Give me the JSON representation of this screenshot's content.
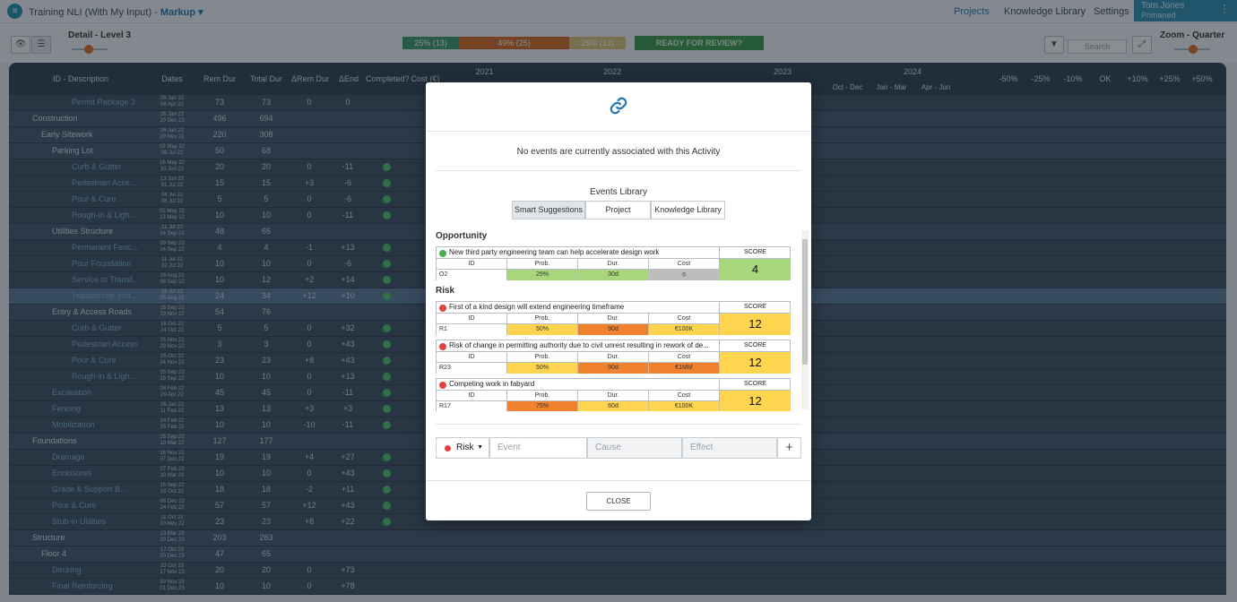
{
  "app": {
    "logo_glyph": "≡",
    "title": "Training NLI (With My Input)",
    "mode": "Markup",
    "nav": [
      "Projects",
      "Knowledge Library",
      "Settings"
    ],
    "user_name": "Tom Jones",
    "user_org": "Primaned"
  },
  "toolbar": {
    "detail_label": "Detail - Level 3",
    "progress": [
      {
        "label": "25% (13)",
        "fraction": 0.25,
        "color": "#3a9a6b"
      },
      {
        "label": "49% (25)",
        "fraction": 0.49,
        "color": "#d4691f"
      },
      {
        "label": "25% (13)",
        "fraction": 0.25,
        "color": "#d8c27a"
      }
    ],
    "ready_label": "READY FOR REVIEW?",
    "search_placeholder": "Search",
    "zoom_label": "Zoom - Quarter"
  },
  "grid": {
    "columns": [
      "ID - Description",
      "Dates",
      "Rem Dur",
      "Total Dur",
      "ΔRem Dur",
      "ΔEnd",
      "Completed?",
      "Cost (€)"
    ],
    "years": [
      "2021",
      "2022",
      "2023",
      "2024"
    ],
    "quarters": [
      "Oct - Dec",
      "Jan - Mar",
      "Apr - Jun"
    ],
    "right_cols": [
      "-50%",
      "-25%",
      "-10%",
      "OK",
      "+10%",
      "+25%",
      "+50%"
    ],
    "rows": [
      {
        "name": "Permit Package 3",
        "dates": [
          "26 Jan 22",
          "08 Apr 22"
        ],
        "rem": "73",
        "total": "73",
        "drem": "0",
        "dend": "0",
        "level": 3,
        "group": false,
        "done": false
      },
      {
        "name": "Construction",
        "dates": [
          "26 Jan 22",
          "20 Dec 23"
        ],
        "rem": "496",
        "total": "694",
        "drem": "",
        "dend": "",
        "level": 0,
        "group": true,
        "done": false
      },
      {
        "name": "Early Sitework",
        "dates": [
          "26 Jan 22",
          "29 Nov 22"
        ],
        "rem": "220",
        "total": "308",
        "drem": "",
        "dend": "",
        "level": 1,
        "group": true,
        "done": false
      },
      {
        "name": "Parking Lot",
        "dates": [
          "02 May 22",
          "08 Jul 22"
        ],
        "rem": "50",
        "total": "68",
        "drem": "",
        "dend": "",
        "level": 2,
        "group": true,
        "done": false
      },
      {
        "name": "Curb & Gutter",
        "dates": [
          "16 May 22",
          "10 Jun 22"
        ],
        "rem": "20",
        "total": "20",
        "drem": "0",
        "dend": "-11",
        "level": 3,
        "group": false,
        "done": true
      },
      {
        "name": "Pedestrian Acce...",
        "dates": [
          "13 Jun 22",
          "01 Jul 22"
        ],
        "rem": "15",
        "total": "15",
        "drem": "+3",
        "dend": "-6",
        "level": 3,
        "group": false,
        "done": true
      },
      {
        "name": "Pour & Cure",
        "dates": [
          "04 Jul 22",
          "08 Jul 22"
        ],
        "rem": "5",
        "total": "5",
        "drem": "0",
        "dend": "-6",
        "level": 3,
        "group": false,
        "done": true
      },
      {
        "name": "Rough-in & Ligh...",
        "dates": [
          "02 May 22",
          "13 May 22"
        ],
        "rem": "10",
        "total": "10",
        "drem": "0",
        "dend": "-11",
        "level": 3,
        "group": false,
        "done": true
      },
      {
        "name": "Utilities Structure",
        "dates": [
          "11 Jul 22",
          "14 Sep 22"
        ],
        "rem": "48",
        "total": "66",
        "drem": "",
        "dend": "",
        "level": 2,
        "group": true,
        "done": false
      },
      {
        "name": "Permanent Fenc...",
        "dates": [
          "09 Sep 22",
          "14 Sep 22"
        ],
        "rem": "4",
        "total": "4",
        "drem": "-1",
        "dend": "+13",
        "level": 3,
        "group": false,
        "done": true
      },
      {
        "name": "Pour Foundation",
        "dates": [
          "11 Jul 22",
          "22 Jul 22"
        ],
        "rem": "10",
        "total": "10",
        "drem": "0",
        "dend": "-6",
        "level": 3,
        "group": false,
        "done": true
      },
      {
        "name": "Service to Transf...",
        "dates": [
          "26 Aug 22",
          "08 Sep 22"
        ],
        "rem": "10",
        "total": "12",
        "drem": "+2",
        "dend": "+14",
        "level": 3,
        "group": false,
        "done": true
      },
      {
        "name": "Transformer Inst...",
        "dates": [
          "25 Jul 22",
          "25 Aug 22"
        ],
        "rem": "24",
        "total": "34",
        "drem": "+12",
        "dend": "+10",
        "level": 3,
        "group": false,
        "done": true
      },
      {
        "name": "Entry & Access Roads",
        "dates": [
          "15 Sep 22",
          "29 Nov 22"
        ],
        "rem": "54",
        "total": "76",
        "drem": "",
        "dend": "",
        "level": 2,
        "group": true,
        "done": false
      },
      {
        "name": "Curb & Gutter",
        "dates": [
          "18 Oct 22",
          "24 Oct 22"
        ],
        "rem": "5",
        "total": "5",
        "drem": "0",
        "dend": "+32",
        "level": 3,
        "group": false,
        "done": true
      },
      {
        "name": "Pedestrian Access",
        "dates": [
          "25 Nov 22",
          "29 Nov 22"
        ],
        "rem": "3",
        "total": "3",
        "drem": "0",
        "dend": "+43",
        "level": 3,
        "group": false,
        "done": true
      },
      {
        "name": "Pour & Cure",
        "dates": [
          "25 Oct 22",
          "24 Nov 22"
        ],
        "rem": "23",
        "total": "23",
        "drem": "+8",
        "dend": "+43",
        "level": 3,
        "group": false,
        "done": true
      },
      {
        "name": "Rough-in & Ligh...",
        "dates": [
          "15 Sep 22",
          "28 Sep 22"
        ],
        "rem": "10",
        "total": "10",
        "drem": "0",
        "dend": "+13",
        "level": 3,
        "group": false,
        "done": true
      },
      {
        "name": "Excavation",
        "dates": [
          "28 Feb 22",
          "29 Apr 22"
        ],
        "rem": "45",
        "total": "45",
        "drem": "0",
        "dend": "-11",
        "level": 2,
        "group": false,
        "done": true
      },
      {
        "name": "Fencing",
        "dates": [
          "26 Jan 22",
          "11 Feb 22"
        ],
        "rem": "13",
        "total": "13",
        "drem": "+3",
        "dend": "+3",
        "level": 2,
        "group": false,
        "done": true
      },
      {
        "name": "Mobilization",
        "dates": [
          "14 Feb 22",
          "25 Feb 22"
        ],
        "rem": "10",
        "total": "10",
        "drem": "-10",
        "dend": "-11",
        "level": 2,
        "group": false,
        "done": true
      },
      {
        "name": "Foundations",
        "dates": [
          "15 Sep 22",
          "10 Mar 23"
        ],
        "rem": "127",
        "total": "177",
        "drem": "",
        "dend": "",
        "level": 0,
        "group": true,
        "done": false
      },
      {
        "name": "Drainage",
        "dates": [
          "16 Nov 22",
          "07 Dec 22"
        ],
        "rem": "19",
        "total": "19",
        "drem": "+4",
        "dend": "+27",
        "level": 2,
        "group": false,
        "done": true
      },
      {
        "name": "Enclosures",
        "dates": [
          "27 Feb 23",
          "10 Mar 23"
        ],
        "rem": "10",
        "total": "10",
        "drem": "0",
        "dend": "+43",
        "level": 2,
        "group": false,
        "done": true
      },
      {
        "name": "Grade & Support B...",
        "dates": [
          "15 Sep 22",
          "10 Oct 22"
        ],
        "rem": "18",
        "total": "18",
        "drem": "-2",
        "dend": "+11",
        "level": 2,
        "group": false,
        "done": true
      },
      {
        "name": "Pour & Cure",
        "dates": [
          "08 Dec 22",
          "24 Feb 23"
        ],
        "rem": "57",
        "total": "57",
        "drem": "+12",
        "dend": "+43",
        "level": 2,
        "group": false,
        "done": true
      },
      {
        "name": "Stub-in Utilities",
        "dates": [
          "11 Oct 22",
          "10 Nov 22"
        ],
        "rem": "23",
        "total": "23",
        "drem": "+8",
        "dend": "+22",
        "level": 2,
        "group": false,
        "done": true
      },
      {
        "name": "Structure",
        "dates": [
          "13 Mar 23",
          "20 Dec 23"
        ],
        "rem": "203",
        "total": "283",
        "drem": "",
        "dend": "",
        "level": 0,
        "group": true,
        "done": false
      },
      {
        "name": "Floor 4",
        "dates": [
          "17 Oct 23",
          "20 Dec 23"
        ],
        "rem": "47",
        "total": "65",
        "drem": "",
        "dend": "",
        "level": 1,
        "group": true,
        "done": false
      },
      {
        "name": "Decking",
        "dates": [
          "23 Oct 23",
          "17 Nov 23"
        ],
        "rem": "20",
        "total": "20",
        "drem": "0",
        "dend": "+73",
        "level": 2,
        "group": false,
        "done": false
      },
      {
        "name": "Final Reinforcing",
        "dates": [
          "20 Nov 23",
          "01 Dec 23"
        ],
        "rem": "10",
        "total": "10",
        "drem": "0",
        "dend": "+78",
        "level": 2,
        "group": false,
        "done": false
      }
    ]
  },
  "modal": {
    "no_events_text": "No events are currently associated with this Activity",
    "library_title": "Events Library",
    "tabs": [
      "Smart Suggestions",
      "Project",
      "Knowledge Library"
    ],
    "opportunity_label": "Opportunity",
    "risk_label": "Risk",
    "col_labels": {
      "id": "ID",
      "prob": "Prob.",
      "dur": "Dur.",
      "cost": "Cost",
      "score": "SCORE"
    },
    "opportunity": {
      "title": "New third party engineering team can help accelerate design work",
      "id": "O2",
      "prob": "25%",
      "dur": "30d",
      "cost": "⦸",
      "score": "4",
      "dot_color": "#4caf50",
      "prob_color": "#a8d67a",
      "dur_color": "#a8d67a",
      "cost_color": "#bdbdbd",
      "score_color": "#a8d67a"
    },
    "risks": [
      {
        "title": "First of a kind design will extend engineering timeframe",
        "id": "R1",
        "prob": "50%",
        "dur": "90d",
        "cost": "€100K",
        "score": "12",
        "prob_color": "#ffd54f",
        "dur_color": "#f0822f",
        "cost_color": "#ffd54f",
        "score_color": "#ffd54f"
      },
      {
        "title": "Risk of change in permitting authority due to civil unrest resulting in rework of de...",
        "id": "R23",
        "prob": "50%",
        "dur": "90d",
        "cost": "€1MM",
        "score": "12",
        "prob_color": "#ffd54f",
        "dur_color": "#f0822f",
        "cost_color": "#f0822f",
        "score_color": "#ffd54f"
      },
      {
        "title": "Competing work in fabyard",
        "id": "R17",
        "prob": "75%",
        "dur": "60d",
        "cost": "€100K",
        "score": "12",
        "prob_color": "#f0822f",
        "dur_color": "#ffd54f",
        "cost_color": "#ffd54f",
        "score_color": "#ffd54f"
      }
    ],
    "new_event": {
      "type": "Risk",
      "event_placeholder": "Event",
      "cause_placeholder": "Cause",
      "effect_placeholder": "Effect",
      "add_glyph": "+"
    },
    "close_label": "CLOSE"
  },
  "colors": {
    "accent": "#1f78b4",
    "risk": "#e04141",
    "opportunity": "#4caf50"
  }
}
